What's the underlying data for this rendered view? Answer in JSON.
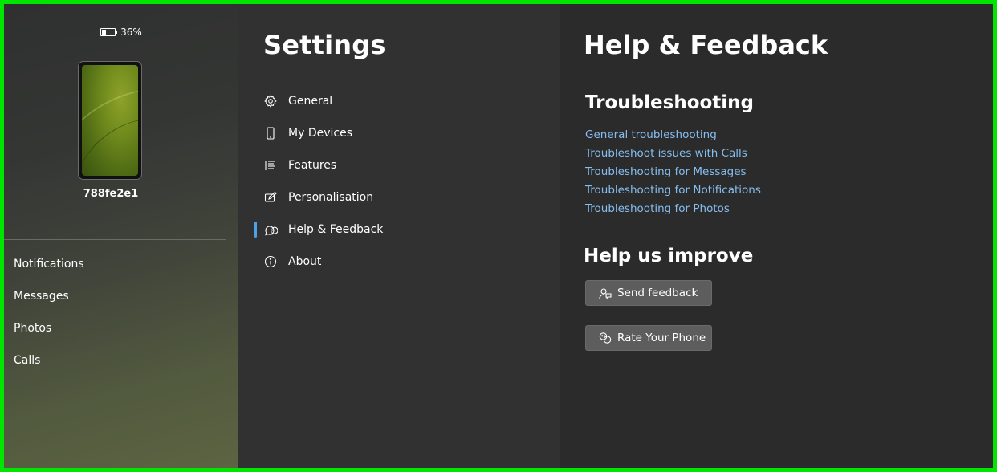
{
  "device": {
    "battery_level": "36%",
    "battery_icon": "battery-icon",
    "name": "788fe2e1",
    "nav": [
      {
        "label": "Notifications"
      },
      {
        "label": "Messages"
      },
      {
        "label": "Photos"
      },
      {
        "label": "Calls"
      }
    ]
  },
  "settings": {
    "title": "Settings",
    "selected": "Help & Feedback",
    "items": [
      {
        "label": "General",
        "icon": "gear-icon"
      },
      {
        "label": "My Devices",
        "icon": "phone-icon"
      },
      {
        "label": "Features",
        "icon": "list-icon"
      },
      {
        "label": "Personalisation",
        "icon": "pen-icon"
      },
      {
        "label": "Help & Feedback",
        "icon": "help-feedback-icon"
      },
      {
        "label": "About",
        "icon": "info-icon"
      }
    ]
  },
  "help": {
    "title": "Help & Feedback",
    "troubleshooting": {
      "title": "Troubleshooting",
      "links": [
        {
          "label": "General troubleshooting"
        },
        {
          "label": "Troubleshoot issues with Calls"
        },
        {
          "label": "Troubleshooting for Messages"
        },
        {
          "label": "Troubleshooting for Notifications"
        },
        {
          "label": "Troubleshooting for Photos"
        }
      ]
    },
    "improve": {
      "title": "Help us improve",
      "send_feedback_label": "Send feedback",
      "rate_label": "Rate Your Phone"
    }
  },
  "colors": {
    "accent": "#4ca1e8",
    "link": "#86bdf0",
    "frame_border": "#00e600"
  }
}
